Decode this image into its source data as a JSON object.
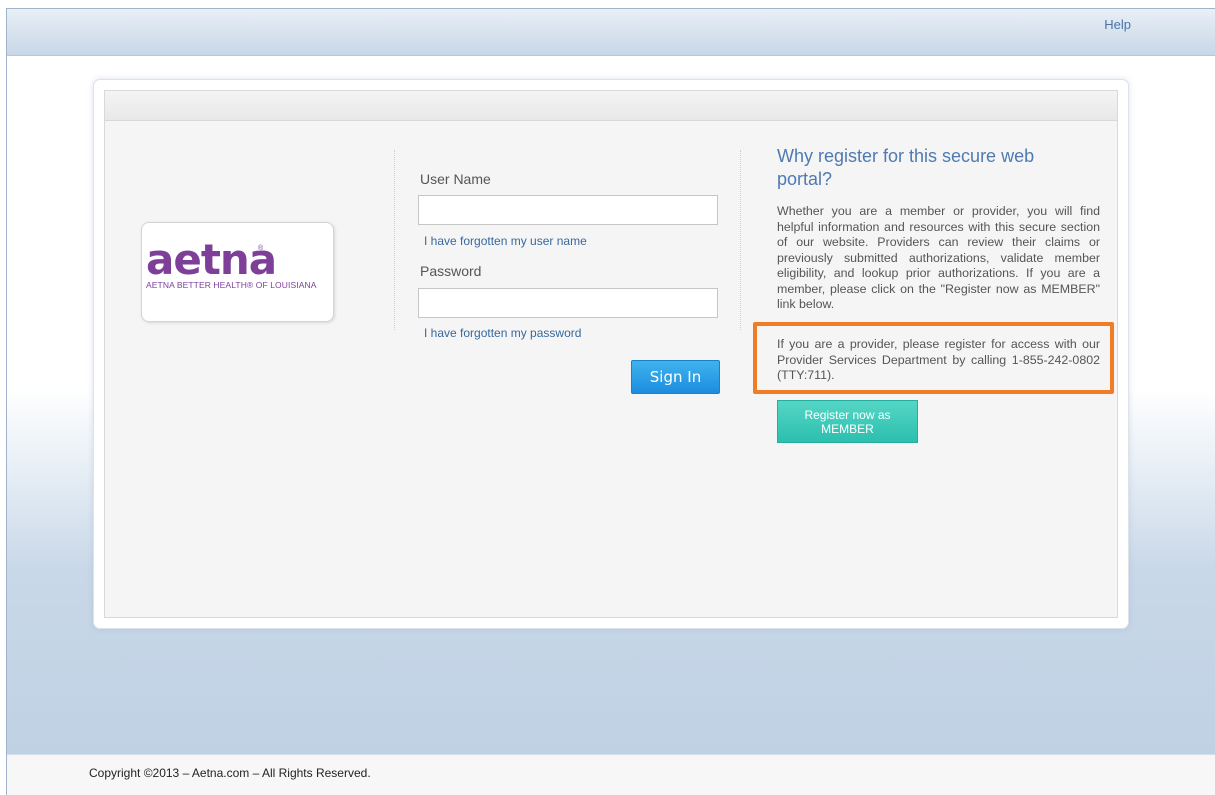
{
  "header": {
    "help_label": "Help"
  },
  "logo": {
    "wordmark": "aetna",
    "registered": "®",
    "tagline": "AETNA BETTER HEALTH® OF LOUISIANA"
  },
  "login": {
    "username_label": "User Name",
    "username_value": "",
    "forgot_username_label": "I have forgotten my user name",
    "password_label": "Password",
    "password_value": "",
    "forgot_password_label": "I have forgotten my password",
    "signin_label": "Sign In"
  },
  "info": {
    "title": "Why register for this secure web portal?",
    "body": "Whether you are a member or provider, you will find helpful information and resources with this secure section of our website. Providers can review their claims or previously submitted authorizations, validate member eligibility, and lookup prior authorizations. If you are a member, please click on the \"Register now as MEMBER\" link below.",
    "provider_note": "If you are a provider, please register for access with our Provider Services Department by calling 1-855-242-0802 (TTY:711).",
    "register_label": "Register now as MEMBER"
  },
  "footer": {
    "copyright": "Copyright ©2013 – Aetna.com – All Rights Reserved."
  },
  "colors": {
    "brand_purple": "#7d3f98",
    "signin_blue": "#1c8ddf",
    "register_teal": "#2cbfae",
    "highlight_orange": "#f07d25",
    "title_blue": "#4e7ab1"
  }
}
